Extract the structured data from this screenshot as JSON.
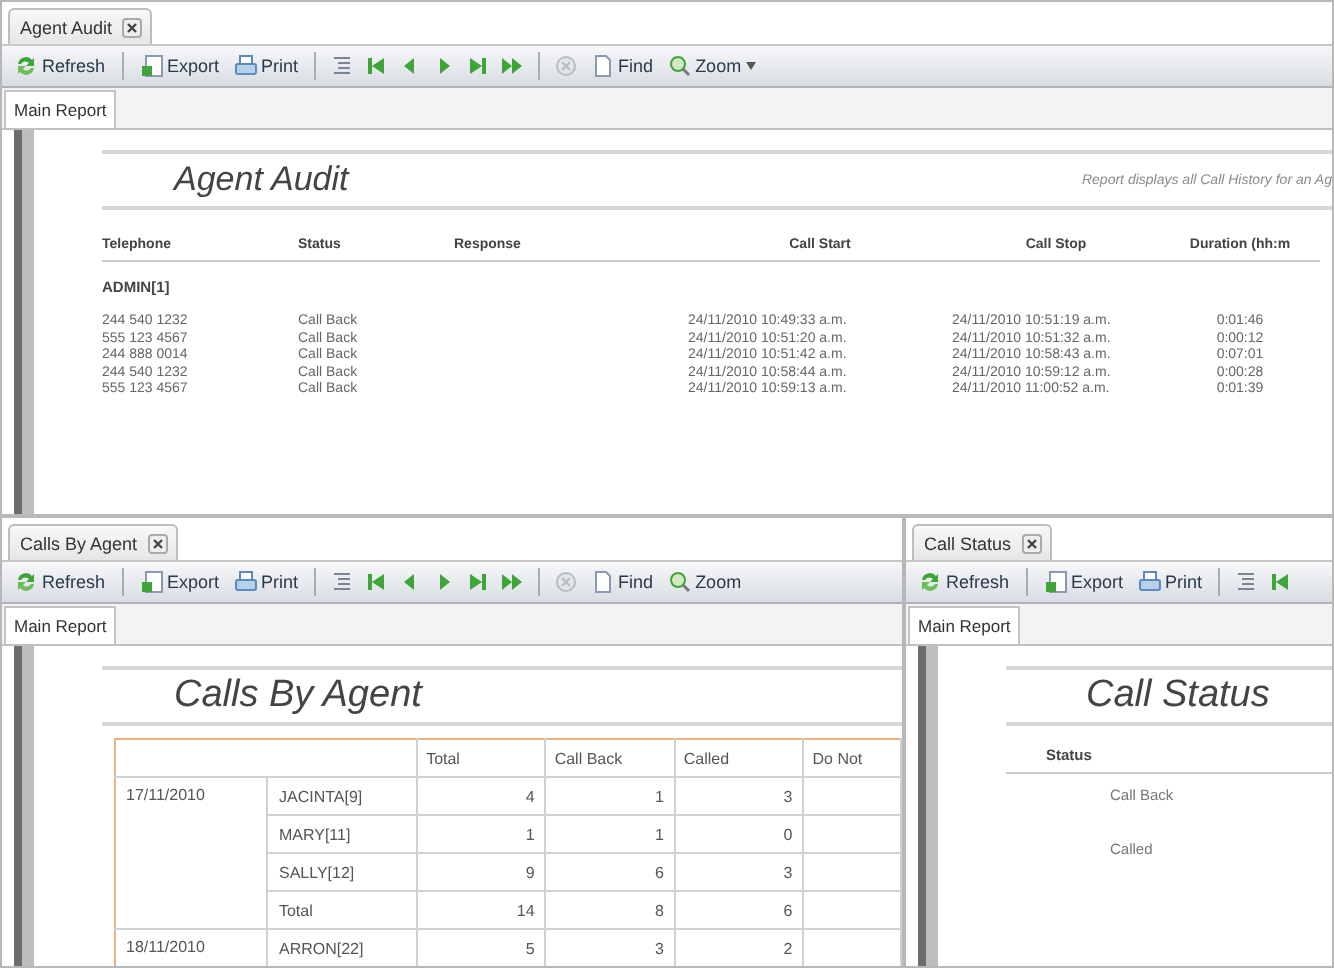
{
  "windows": [
    {
      "tab": {
        "label": "Agent Audit",
        "selected": true
      },
      "toolbar": [
        {
          "kind": "refresh",
          "label": "Refresh"
        },
        {
          "kind": "separator"
        },
        {
          "kind": "export",
          "label": "Export"
        },
        {
          "kind": "print",
          "label": "Print"
        },
        {
          "kind": "separator"
        },
        {
          "kind": "outline"
        },
        {
          "kind": "first"
        },
        {
          "kind": "prev"
        },
        {
          "kind": "next"
        },
        {
          "kind": "last"
        },
        {
          "kind": "forward"
        },
        {
          "kind": "separator"
        },
        {
          "kind": "stop"
        },
        {
          "kind": "find",
          "label": "Find"
        },
        {
          "kind": "zoom",
          "label": "Zoom",
          "dropdown": true
        }
      ],
      "subtab": {
        "label": "Main Report",
        "selected": true
      },
      "report": {
        "kind": "audit",
        "title": "Agent Audit",
        "description": "Report displays all Call History for an Ag",
        "columns": [
          "Telephone",
          "Status",
          "Response",
          "Call Start",
          "Call Stop",
          "Duration (hh:m"
        ],
        "groups": [
          {
            "name": "ADMIN[1]",
            "rows": [
              {
                "telephone": "244 540 1232",
                "status": "Call Back",
                "call_start": "24/11/2010 10:49:33 a.m.",
                "call_stop": "24/11/2010 10:51:19 a.m.",
                "duration": "0:01:46"
              },
              {
                "telephone": "555 123 4567",
                "status": "Call Back",
                "call_start": "24/11/2010 10:51:20 a.m.",
                "call_stop": "24/11/2010 10:51:32 a.m.",
                "duration": "0:00:12"
              },
              {
                "telephone": "244 888 0014",
                "status": "Call Back",
                "call_start": "24/11/2010 10:51:42 a.m.",
                "call_stop": "24/11/2010 10:58:43 a.m.",
                "duration": "0:07:01"
              },
              {
                "telephone": "244 540 1232",
                "status": "Call Back",
                "call_start": "24/11/2010 10:58:44 a.m.",
                "call_stop": "24/11/2010 10:59:12 a.m.",
                "duration": "0:00:28"
              },
              {
                "telephone": "555 123 4567",
                "status": "Call Back",
                "call_start": "24/11/2010 10:59:13 a.m.",
                "call_stop": "24/11/2010 11:00:52 a.m.",
                "duration": "0:01:39"
              }
            ]
          }
        ]
      }
    },
    {
      "tab": {
        "label": "Calls By Agent",
        "selected": true
      },
      "toolbar": [
        {
          "kind": "refresh",
          "label": "Refresh"
        },
        {
          "kind": "separator"
        },
        {
          "kind": "export",
          "label": "Export"
        },
        {
          "kind": "print",
          "label": "Print"
        },
        {
          "kind": "separator"
        },
        {
          "kind": "outline"
        },
        {
          "kind": "first"
        },
        {
          "kind": "prev"
        },
        {
          "kind": "next"
        },
        {
          "kind": "last"
        },
        {
          "kind": "forward"
        },
        {
          "kind": "separator"
        },
        {
          "kind": "stop"
        },
        {
          "kind": "find",
          "label": "Find"
        },
        {
          "kind": "zoom",
          "label": "Zoom",
          "dropdown": false
        }
      ],
      "subtab": {
        "label": "Main Report",
        "selected": true
      },
      "report": {
        "kind": "crosstab",
        "title": "Calls By Agent",
        "columns": [
          "Total",
          "Call Back",
          "Called",
          "Do Not"
        ],
        "groups": [
          {
            "date": "17/11/2010",
            "rows": [
              {
                "agent": "JACINTA[9]",
                "values": [
                  "4",
                  "1",
                  "3"
                ]
              },
              {
                "agent": "MARY[11]",
                "values": [
                  "1",
                  "1",
                  "0"
                ]
              },
              {
                "agent": "SALLY[12]",
                "values": [
                  "9",
                  "6",
                  "3"
                ]
              },
              {
                "agent": "Total",
                "values": [
                  "14",
                  "8",
                  "6"
                ]
              }
            ]
          },
          {
            "date": "18/11/2010",
            "rows": [
              {
                "agent": "ARRON[22]",
                "values": [
                  "5",
                  "3",
                  "2"
                ]
              }
            ]
          }
        ]
      }
    },
    {
      "tab": {
        "label": "Call Status",
        "selected": true
      },
      "toolbar": [
        {
          "kind": "refresh",
          "label": "Refresh"
        },
        {
          "kind": "separator"
        },
        {
          "kind": "export",
          "label": "Export"
        },
        {
          "kind": "print",
          "label": "Print"
        },
        {
          "kind": "separator"
        },
        {
          "kind": "outline"
        },
        {
          "kind": "first"
        }
      ],
      "subtab": {
        "label": "Main Report",
        "selected": true
      },
      "report": {
        "kind": "status",
        "title": "Call Status",
        "column": "Status",
        "rows": [
          "Call Back",
          "Called"
        ]
      }
    }
  ]
}
